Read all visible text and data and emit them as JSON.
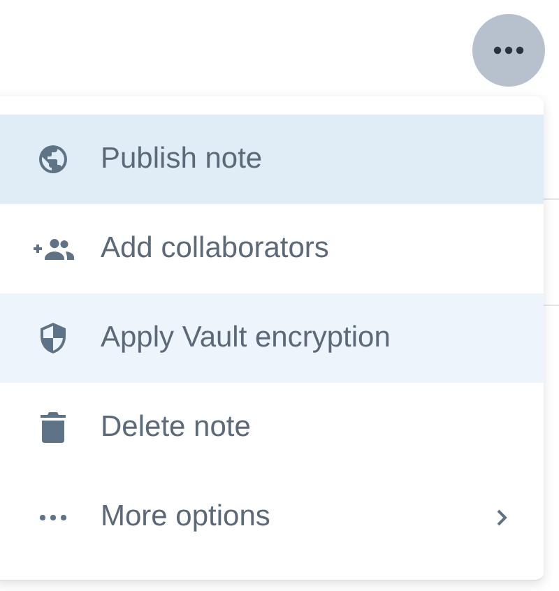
{
  "more_button": {
    "pressed": true
  },
  "menu": {
    "items": [
      {
        "label": "Publish note",
        "selected": true,
        "hovered": false,
        "has_submenu": false
      },
      {
        "label": "Add collaborators",
        "selected": false,
        "hovered": false,
        "has_submenu": false
      },
      {
        "label": "Apply Vault encryption",
        "selected": false,
        "hovered": true,
        "has_submenu": false
      },
      {
        "label": "Delete note",
        "selected": false,
        "hovered": false,
        "has_submenu": false
      },
      {
        "label": "More options",
        "selected": false,
        "hovered": false,
        "has_submenu": true
      }
    ]
  }
}
